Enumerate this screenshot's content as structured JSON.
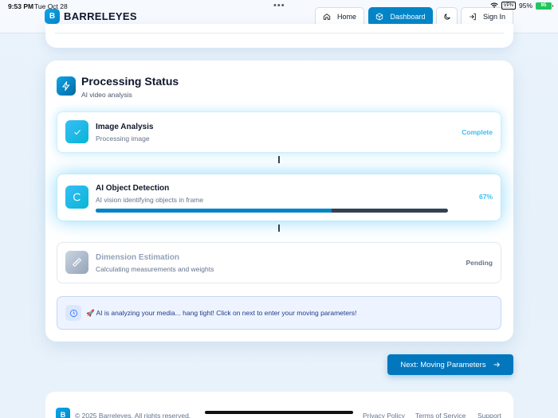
{
  "status_bar": {
    "time": "9:53 PM",
    "date": "Tue Oct 28",
    "vpn": "VPN",
    "battery_pct": "95%",
    "battery_icon_text": "95"
  },
  "header": {
    "brand_initial": "B",
    "brand_name": "BARRELEYES",
    "nav": {
      "home": "Home",
      "dashboard": "Dashboard",
      "signin": "Sign In"
    }
  },
  "processing": {
    "title": "Processing Status",
    "subtitle": "AI video analysis",
    "steps": [
      {
        "title": "Image Analysis",
        "desc": "Processing image",
        "status": "Complete"
      },
      {
        "title": "AI Object Detection",
        "desc": "AI vision identifying objects in frame",
        "status": "67%",
        "progress": 0.67
      },
      {
        "title": "Dimension Estimation",
        "desc": "Calculating measurements and weights",
        "status": "Pending"
      }
    ],
    "notice": "🚀 AI is analyzing your media... hang tight! Click on next to enter your moving parameters!"
  },
  "actions": {
    "next": "Next: Moving Parameters"
  },
  "footer": {
    "brand_initial": "B",
    "copyright": "© 2025 Barreleyes. All rights reserved.",
    "links": [
      "Privacy Policy",
      "Terms of Service",
      "Support"
    ]
  },
  "colors": {
    "accent": "#0284c7",
    "cyan": "#38bdf8",
    "track": "#334155"
  }
}
